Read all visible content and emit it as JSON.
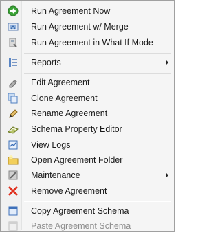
{
  "menu": {
    "items": [
      {
        "label": "Run Agreement Now",
        "icon": "run-green-icon"
      },
      {
        "label": "Run Agreement w/ Merge",
        "icon": "merge-icon"
      },
      {
        "label": "Run Agreement in What If Mode",
        "icon": "whatif-icon"
      },
      {
        "label": "Reports",
        "icon": "reports-icon",
        "submenu": true
      },
      {
        "label": "Edit Agreement",
        "icon": "edit-icon"
      },
      {
        "label": "Clone Agreement",
        "icon": "clone-icon"
      },
      {
        "label": "Rename Agreement",
        "icon": "pencil-icon"
      },
      {
        "label": "Schema Property Editor",
        "icon": "schema-icon"
      },
      {
        "label": "View Logs",
        "icon": "logs-icon"
      },
      {
        "label": "Open Agreement Folder",
        "icon": "folder-icon"
      },
      {
        "label": "Maintenance",
        "icon": "maintenance-icon",
        "submenu": true
      },
      {
        "label": "Remove Agreement",
        "icon": "remove-x-icon"
      },
      {
        "label": "Copy Agreement Schema",
        "icon": "copy-icon"
      },
      {
        "label": "Paste Agreement Schema",
        "icon": "paste-icon",
        "disabled": true
      }
    ]
  },
  "colors": {
    "menu_bg": "#f5f5f5",
    "text": "#1a1a1a",
    "disabled_text": "#8d8d8d",
    "remove_red": "#e0301e",
    "run_green": "#3aa335"
  }
}
